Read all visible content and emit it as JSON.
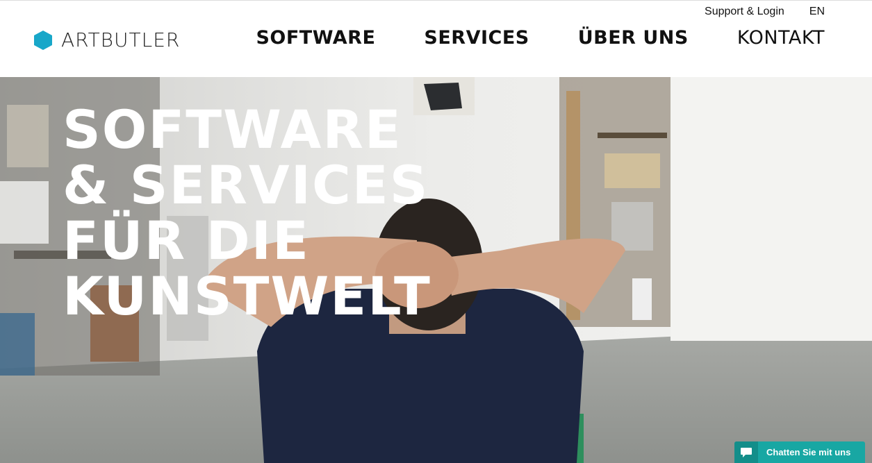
{
  "brand": {
    "name": "ARTBUTLER",
    "logo_color": "#18a7c9"
  },
  "top_links": {
    "support_login": "Support & Login",
    "language": "EN"
  },
  "nav": {
    "software": "SOFTWARE",
    "services": "SERVICES",
    "about": "ÜBER UNS",
    "contact": "KONTAKT"
  },
  "hero": {
    "line1": "SOFTWARE",
    "line2": "& SERVICES",
    "line3": "FÜR DIE",
    "line4": "KUNSTWELT"
  },
  "chat": {
    "label": "Chatten Sie mit uns",
    "color": "#18a7a3",
    "icon": "chat-bubble-icon"
  }
}
